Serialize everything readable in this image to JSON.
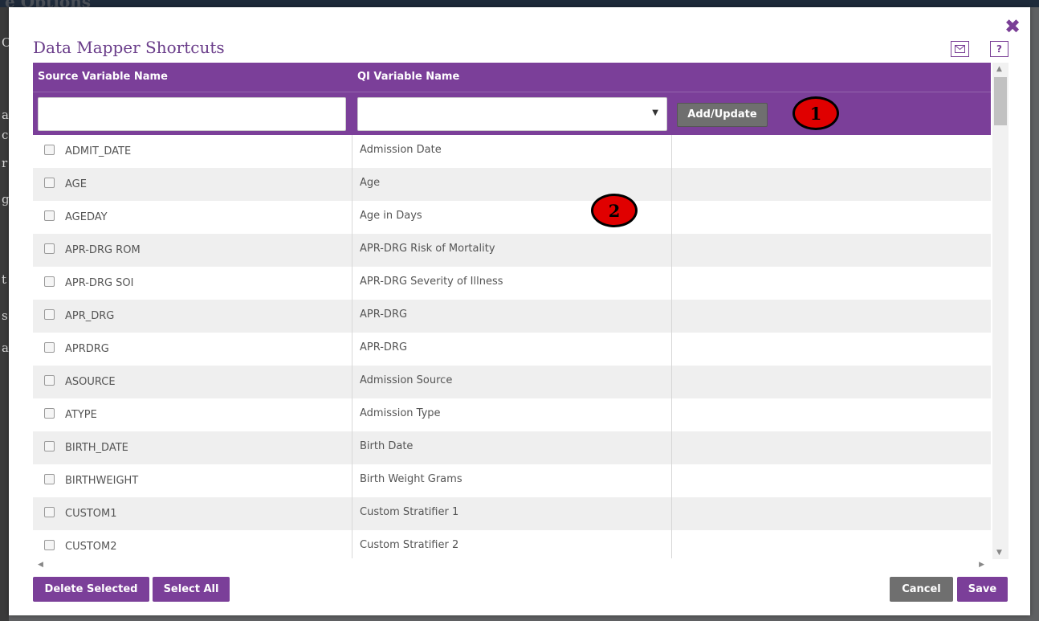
{
  "background": {
    "title_fragment": "e Options",
    "strip_letters": [
      "C",
      "a",
      "c",
      "r",
      "g",
      "t",
      "s",
      "al"
    ]
  },
  "dialog": {
    "title": "Data Mapper Shortcuts",
    "close_glyph": "✖",
    "help_glyph": "?"
  },
  "table": {
    "headers": {
      "source": "Source Variable Name",
      "qi": "QI Variable Name"
    },
    "filters": {
      "source_value": "",
      "qi_selected": "",
      "add_update_label": "Add/Update"
    },
    "rows": [
      {
        "source": "ADMIT_DATE",
        "qi": "Admission Date"
      },
      {
        "source": "AGE",
        "qi": "Age"
      },
      {
        "source": "AGEDAY",
        "qi": "Age in Days"
      },
      {
        "source": "APR-DRG ROM",
        "qi": "APR-DRG Risk of Mortality"
      },
      {
        "source": "APR-DRG SOI",
        "qi": "APR-DRG Severity of Illness"
      },
      {
        "source": "APR_DRG",
        "qi": "APR-DRG"
      },
      {
        "source": "APRDRG",
        "qi": "APR-DRG"
      },
      {
        "source": "ASOURCE",
        "qi": "Admission Source"
      },
      {
        "source": "ATYPE",
        "qi": "Admission Type"
      },
      {
        "source": "BIRTH_DATE",
        "qi": "Birth Date"
      },
      {
        "source": "BIRTHWEIGHT",
        "qi": "Birth Weight Grams"
      },
      {
        "source": "CUSTOM1",
        "qi": "Custom Stratifier 1"
      },
      {
        "source": "CUSTOM2",
        "qi": "Custom Stratifier 2"
      }
    ]
  },
  "callouts": [
    "1",
    "2"
  ],
  "footer": {
    "delete_selected": "Delete Selected",
    "select_all": "Select All",
    "cancel": "Cancel",
    "save": "Save"
  },
  "colors": {
    "accent_purple": "#7b3f99",
    "button_gray": "#6f6f6f",
    "callout_red": "#e00000"
  },
  "icons": [
    "close-icon",
    "mail-icon",
    "help-icon",
    "dropdown-arrow-icon",
    "checkbox-icon"
  ]
}
